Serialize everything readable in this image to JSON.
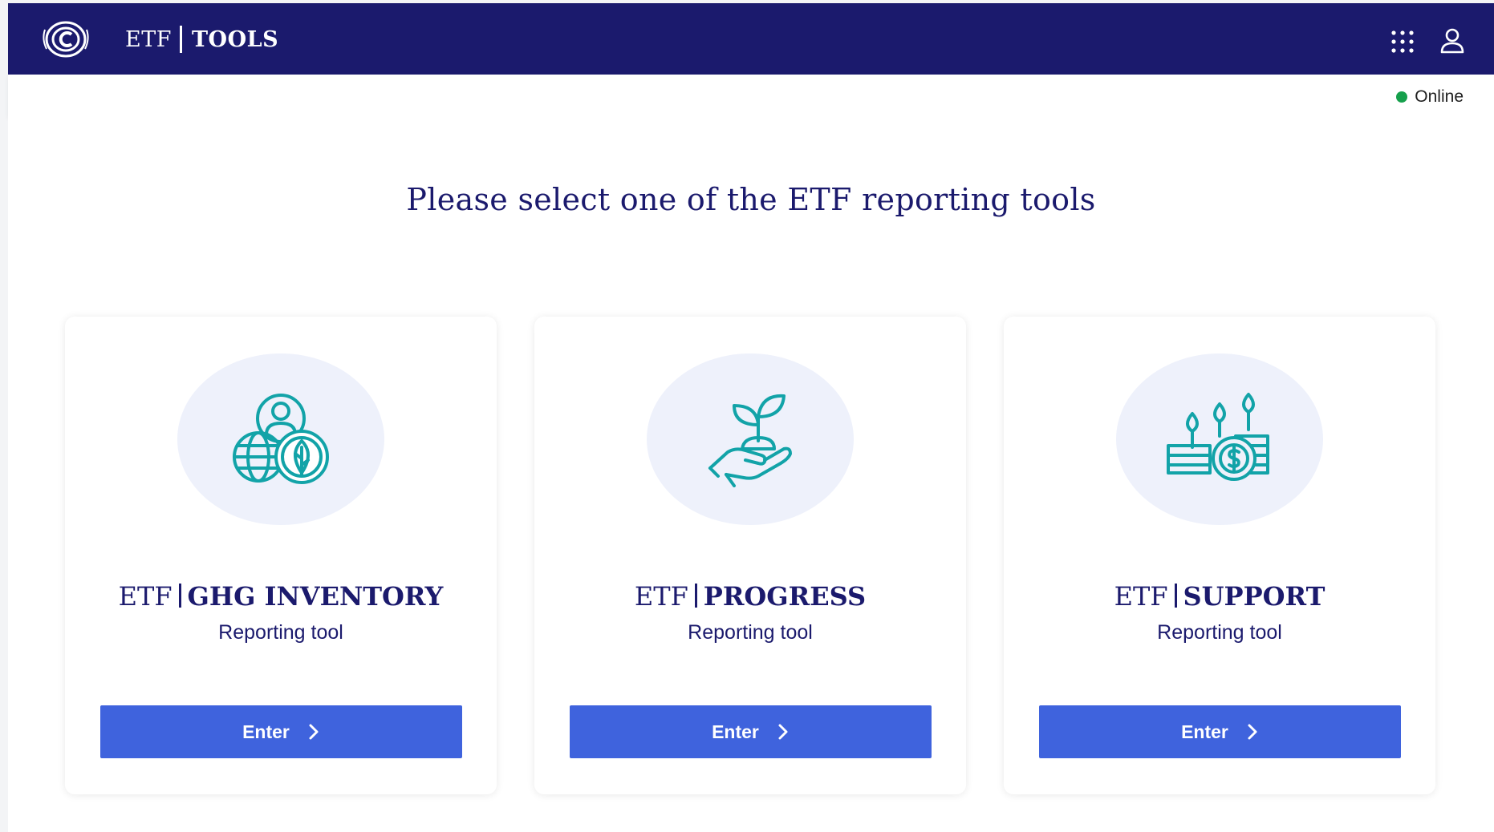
{
  "header": {
    "brand_prefix": "ETF",
    "brand_name": "TOOLS",
    "logo_icon": "un-climate-logo-icon",
    "apps_icon": "apps-grid-icon",
    "user_icon": "user-icon",
    "background_color": "#1b1a6d"
  },
  "status": {
    "label": "Online",
    "color": "#16a04c"
  },
  "main": {
    "heading": "Please select one of the ETF reporting tools",
    "cards": [
      {
        "prefix": "ETF",
        "name": "GHG INVENTORY",
        "subtitle": "Reporting tool",
        "button_label": "Enter",
        "icon": "globe-person-leaf-icon"
      },
      {
        "prefix": "ETF",
        "name": "PROGRESS",
        "subtitle": "Reporting tool",
        "button_label": "Enter",
        "icon": "hand-sprout-icon"
      },
      {
        "prefix": "ETF",
        "name": "SUPPORT",
        "subtitle": "Reporting tool",
        "button_label": "Enter",
        "icon": "coins-plants-icon"
      }
    ],
    "accent_color": "#3f63dd",
    "icon_color": "#12a3a8"
  }
}
